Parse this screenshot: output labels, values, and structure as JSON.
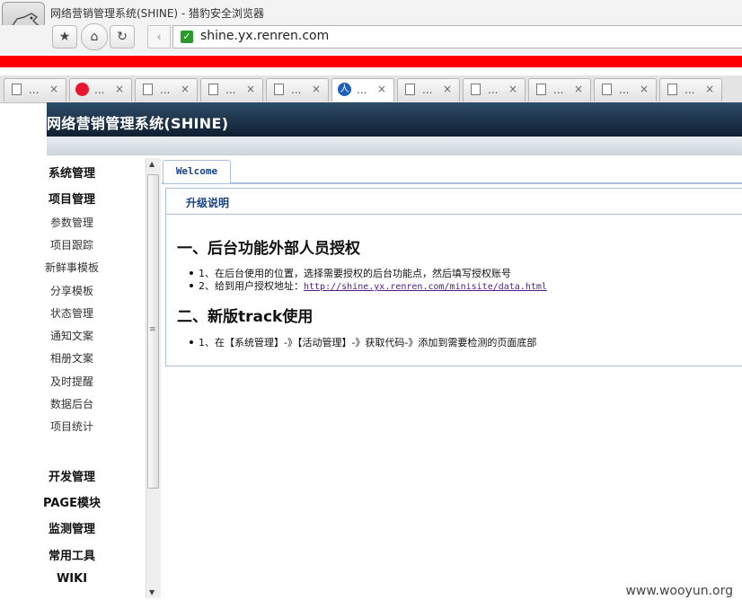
{
  "browser": {
    "window_title": "网络营销管理系统(SHINE) - 猎豹安全浏览器",
    "url": "shine.yx.renren.com",
    "tabs": [
      {
        "label": "...",
        "icon": "page-icon"
      },
      {
        "label": "...",
        "icon": "weibo-icon"
      },
      {
        "label": "...",
        "icon": "page-icon"
      },
      {
        "label": "...",
        "icon": "page-icon"
      },
      {
        "label": "...",
        "icon": "page-icon"
      },
      {
        "label": "...",
        "icon": "renren-icon",
        "active": true
      },
      {
        "label": "...",
        "icon": "page-icon"
      },
      {
        "label": "...",
        "icon": "page-icon"
      },
      {
        "label": "...",
        "icon": "page-icon"
      },
      {
        "label": "...",
        "icon": "page-icon"
      },
      {
        "label": "...",
        "icon": "page-icon"
      }
    ],
    "close_glyph": "×"
  },
  "app": {
    "title": "网络营销管理系统(SHINE)"
  },
  "sidebar": {
    "items": [
      {
        "label": "系统管理",
        "bold": true
      },
      {
        "label": "项目管理",
        "bold": true
      },
      {
        "label": "参数管理"
      },
      {
        "label": "项目跟踪"
      },
      {
        "label": "新鲜事模板"
      },
      {
        "label": "分享模板"
      },
      {
        "label": "状态管理"
      },
      {
        "label": "通知文案"
      },
      {
        "label": "相册文案"
      },
      {
        "label": "及时提醒"
      },
      {
        "label": "数据后台"
      },
      {
        "label": "项目统计"
      },
      {
        "label": "开发管理",
        "bold": true
      },
      {
        "label": "PAGE模块",
        "bold": true
      },
      {
        "label": "监测管理",
        "bold": true
      },
      {
        "label": "常用工具",
        "bold": true
      },
      {
        "label": "WIKI",
        "bold": true
      }
    ]
  },
  "content": {
    "tab_label": "Welcome",
    "panel_title": "升级说明",
    "section1_heading": "一、后台功能外部人员授权",
    "section1_item1": "1、在后台使用的位置，选择需要授权的后台功能点，然后填写授权账号",
    "section1_item2_prefix": "2、给到用户授权地址：",
    "section1_item2_link": "http://shine.yx.renren.com/minisite/data.html",
    "section2_heading": "二、新版track使用",
    "section2_item1": "1、在【系统管理】-》【活动管理】-》获取代码-》添加到需要检测的页面底部"
  },
  "watermark": "www.wooyun.org",
  "colors": {
    "header_dark": "#0f1f31",
    "accent_blue": "#15428b",
    "bookmark_red": "#ff0000"
  }
}
